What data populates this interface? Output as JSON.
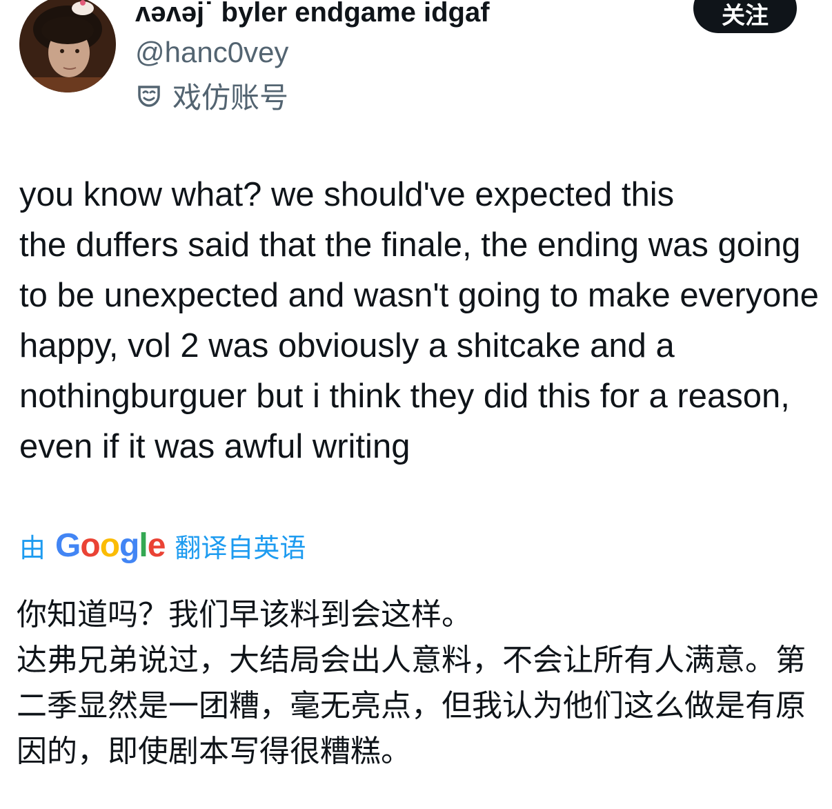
{
  "header": {
    "display_name": "ʌəʌəj˙ byler endgame idgaf",
    "handle": "@hanc0vey",
    "label": "戏仿账号",
    "label_icon": "parody-mask-icon",
    "follow_label": "关注"
  },
  "tweet": {
    "text": "you know what? we should've expected this\nthe duffers said that the finale, the ending was going to be unexpected and wasn't going to make everyone happy, vol 2 was obviously a shitcake and a nothingburguer but i think they did this for a reason, even if it was awful writing"
  },
  "translation": {
    "prefix": "由",
    "provider": "Google",
    "suffix": "翻译自英语",
    "text": "你知道吗？我们早该料到会这样。\n达弗兄弟说过，大结局会出人意料，不会让所有人满意。第二季显然是一团糟，毫无亮点，但我认为他们这么做是有原因的，即使剧本写得很糟糕。"
  },
  "colors": {
    "text": "#0f1419",
    "secondary": "#536471",
    "link": "#1d9bf0",
    "button_bg": "#0f1419",
    "google_blue": "#4285F4",
    "google_red": "#EA4335",
    "google_yellow": "#FBBC05",
    "google_green": "#34A853"
  }
}
